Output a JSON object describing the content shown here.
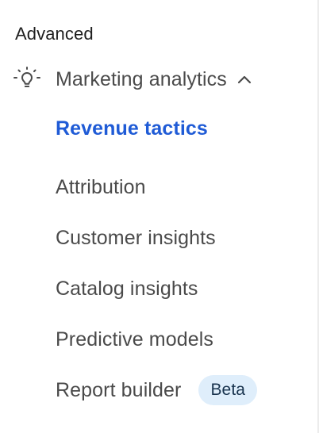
{
  "nav": {
    "section_title": "Advanced",
    "group": {
      "icon": "lightbulb-icon",
      "label": "Marketing analytics",
      "expanded": true,
      "chevron_icon": "chevron-up-icon"
    },
    "items": [
      {
        "label": "Revenue tactics",
        "active": true
      },
      {
        "label": "Attribution",
        "active": false
      },
      {
        "label": "Customer insights",
        "active": false
      },
      {
        "label": "Catalog insights",
        "active": false
      },
      {
        "label": "Predictive models",
        "active": false
      },
      {
        "label": "Report builder",
        "active": false,
        "badge": "Beta"
      }
    ]
  },
  "colors": {
    "active": "#1f5bd6",
    "text": "#4a4a4a",
    "badge_bg": "#dfeefb",
    "badge_text": "#17324d"
  }
}
